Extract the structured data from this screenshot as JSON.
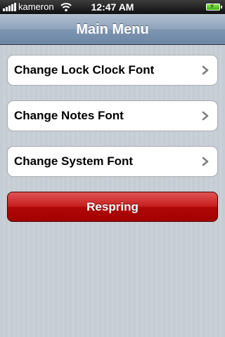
{
  "status_bar": {
    "carrier": "kameron",
    "time": "12:47 AM",
    "icons": [
      "signal-icon",
      "wifi-icon",
      "battery-charging-icon"
    ]
  },
  "nav": {
    "title": "Main Menu"
  },
  "menu": {
    "items": [
      {
        "label": "Change Lock Clock Font",
        "icon": "chevron-right-icon"
      },
      {
        "label": "Change Notes Font",
        "icon": "chevron-right-icon"
      },
      {
        "label": "Change System Font",
        "icon": "chevron-right-icon"
      }
    ]
  },
  "respring": {
    "label": "Respring",
    "color": "#b00808"
  },
  "colors": {
    "background": "#c5ccd4",
    "nav_bar": "#8da2bb",
    "chevron": "#7f7f7f"
  }
}
